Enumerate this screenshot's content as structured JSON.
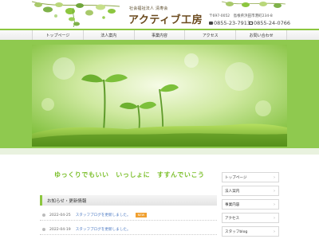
{
  "header": {
    "org_name": "社会福祉法人 清寿会",
    "site_name": "アクティブ工房",
    "address": "〒697-0052　島根県浜田市港町234-8",
    "tel": "0855-23-7913",
    "fax": "0855-24-0766"
  },
  "nav": {
    "items": [
      "トップページ",
      "法人案内",
      "事業内容",
      "アクセス",
      "お問い合わせ"
    ]
  },
  "catchphrase": "ゆっくりでもいい　いっしょに　すすんでいこう",
  "news": {
    "title": "お知らせ・更新情報",
    "items": [
      {
        "date": "2022-04-25",
        "text": "スタッフブログを更新しました。",
        "badge": "NEW"
      },
      {
        "date": "2022-04-19",
        "text": "スタッフブログを更新しました。",
        "badge": ""
      }
    ]
  },
  "sidebar": {
    "items": [
      "トップページ",
      "法人案内",
      "事業内容",
      "アクセス",
      "スタッフblog"
    ]
  },
  "colors": {
    "accent": "#8cc63f",
    "catch": "#7bbf2a",
    "brand_text": "#6b4a1e",
    "link": "#4a78c2"
  }
}
